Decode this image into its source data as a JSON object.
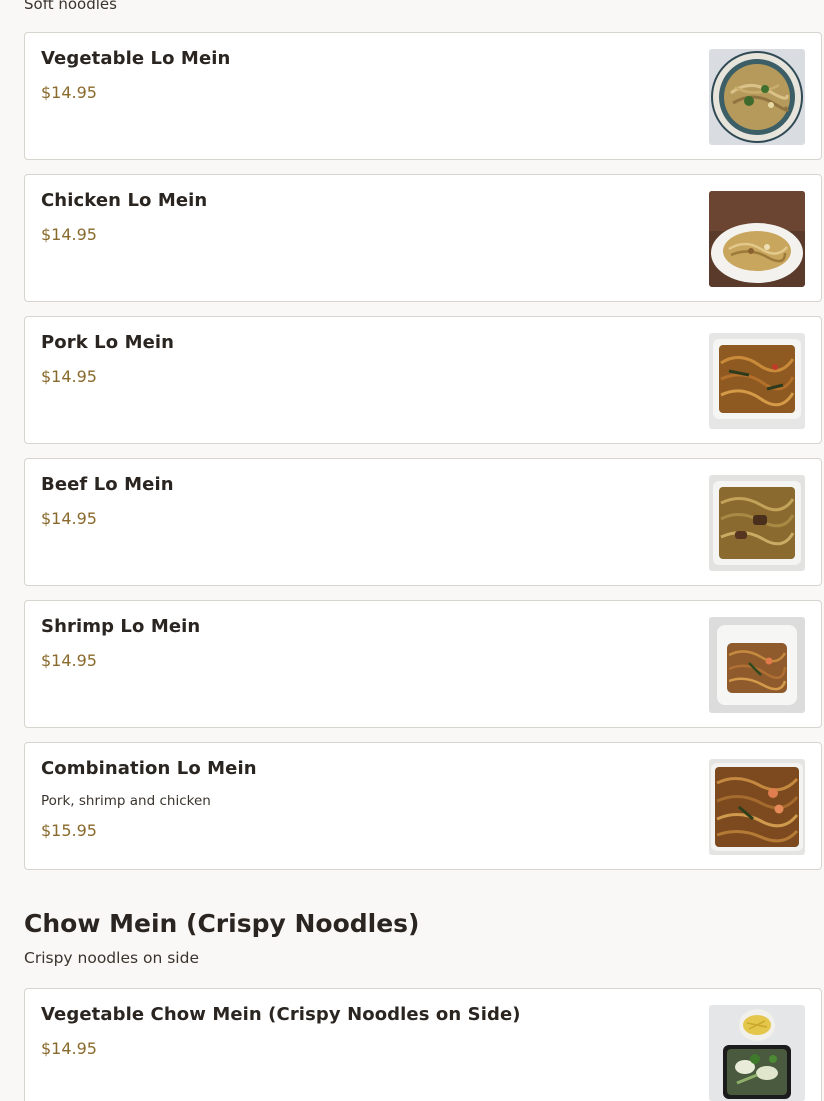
{
  "lo_mein_section": {
    "description": "Soft noodles",
    "items": [
      {
        "name": "Vegetable Lo Mein",
        "price": "$14.95"
      },
      {
        "name": "Chicken Lo Mein",
        "price": "$14.95"
      },
      {
        "name": "Pork Lo Mein",
        "price": "$14.95"
      },
      {
        "name": "Beef Lo Mein",
        "price": "$14.95"
      },
      {
        "name": "Shrimp Lo Mein",
        "price": "$14.95"
      },
      {
        "name": "Combination Lo Mein",
        "description": "Pork, shrimp and chicken",
        "price": "$15.95"
      }
    ]
  },
  "chow_mein_section": {
    "title": "Chow Mein (Crispy Noodles)",
    "description": "Crispy noodles on side",
    "items": [
      {
        "name": "Vegetable Chow Mein (Crispy Noodles on Side)",
        "price": "$14.95"
      }
    ]
  }
}
